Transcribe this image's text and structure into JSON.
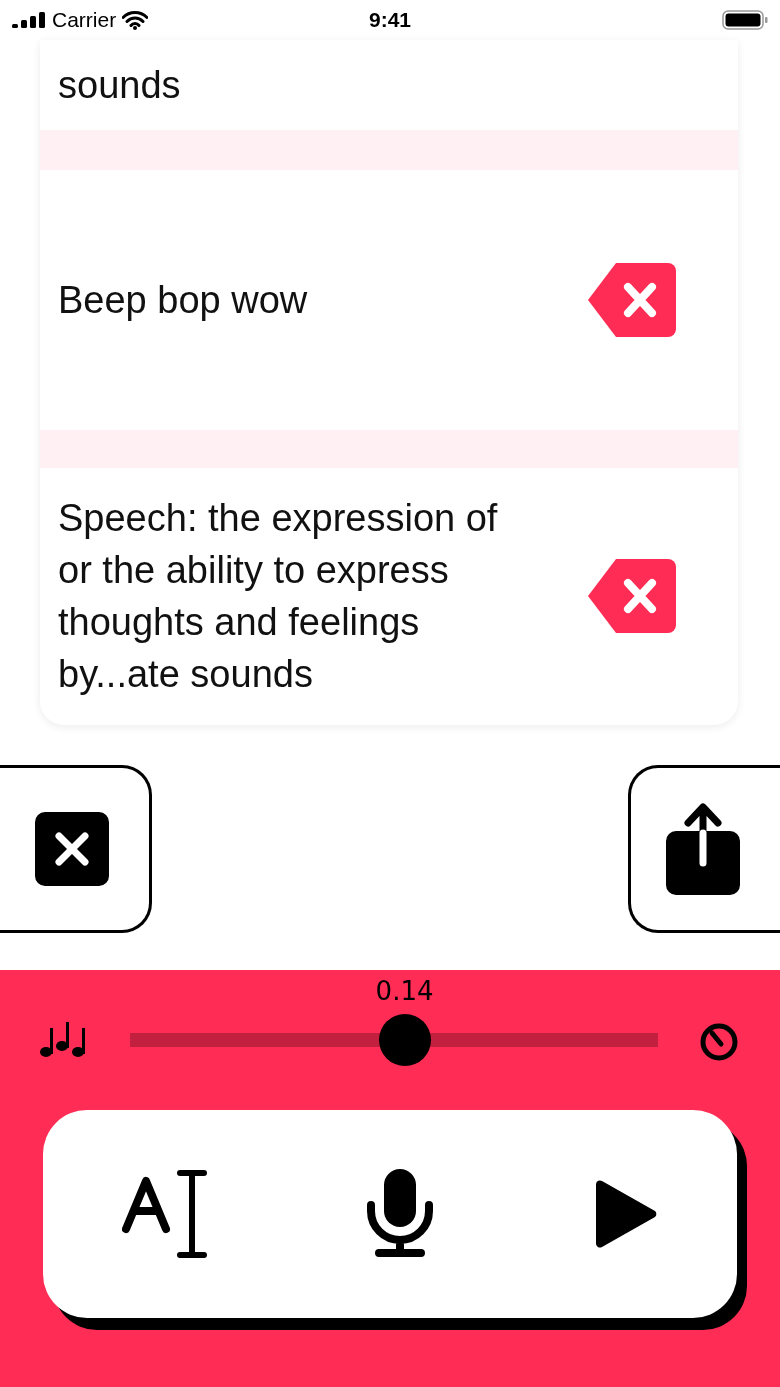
{
  "status_bar": {
    "carrier": "Carrier",
    "time": "9:41"
  },
  "phrases": [
    {
      "text": "sounds",
      "deletable": false
    },
    {
      "text": "Beep bop wow",
      "deletable": true
    },
    {
      "text": "Speech: the expression of or the ability to express thoughts and feelings by...ate sounds",
      "deletable": true
    }
  ],
  "speed": {
    "reading": "0.14",
    "level": 0.52
  }
}
